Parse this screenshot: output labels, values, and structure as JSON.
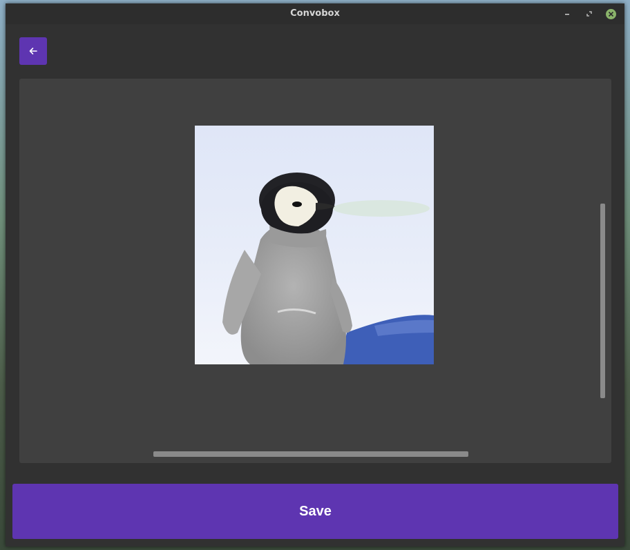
{
  "window": {
    "title": "Convobox",
    "controls": [
      "minimize-icon",
      "maximize-icon",
      "close-icon"
    ]
  },
  "toolbar": {
    "back_icon": "arrow-left-icon"
  },
  "viewer": {
    "image_subject": "penguin-chick"
  },
  "actions": {
    "save_label": "Save"
  },
  "colors": {
    "accent": "#5e35b1",
    "window_bg": "#313131",
    "viewer_bg": "#404040",
    "scrollbar": "#8a8a8a",
    "close_button": "#8ab36a"
  }
}
